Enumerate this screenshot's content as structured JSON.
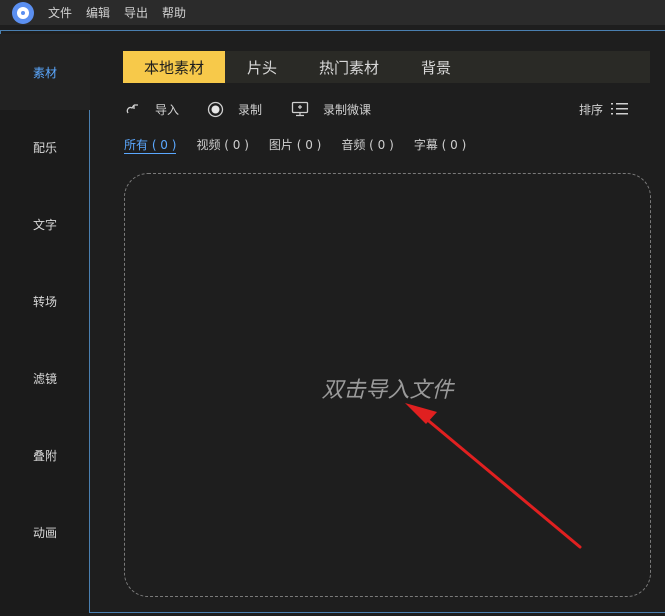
{
  "menu": [
    "文件",
    "编辑",
    "导出",
    "帮助"
  ],
  "sidebar": [
    "素材",
    "配乐",
    "文字",
    "转场",
    "滤镜",
    "叠附",
    "动画"
  ],
  "tabs": [
    "本地素材",
    "片头",
    "热门素材",
    "背景"
  ],
  "toolbar": {
    "import": "导入",
    "record": "录制",
    "record_lecture": "录制微课",
    "sort": "排序"
  },
  "filters": [
    "所有 ( 0 )",
    "视频 ( 0 )",
    "图片 ( 0 )",
    "音频 ( 0 )",
    "字幕 ( 0 )"
  ],
  "drop_hint": "双击导入文件",
  "colors": {
    "accent_tab": "#f7c94a",
    "active_blue": "#5ba8ff",
    "arrow_red": "#e02020"
  }
}
